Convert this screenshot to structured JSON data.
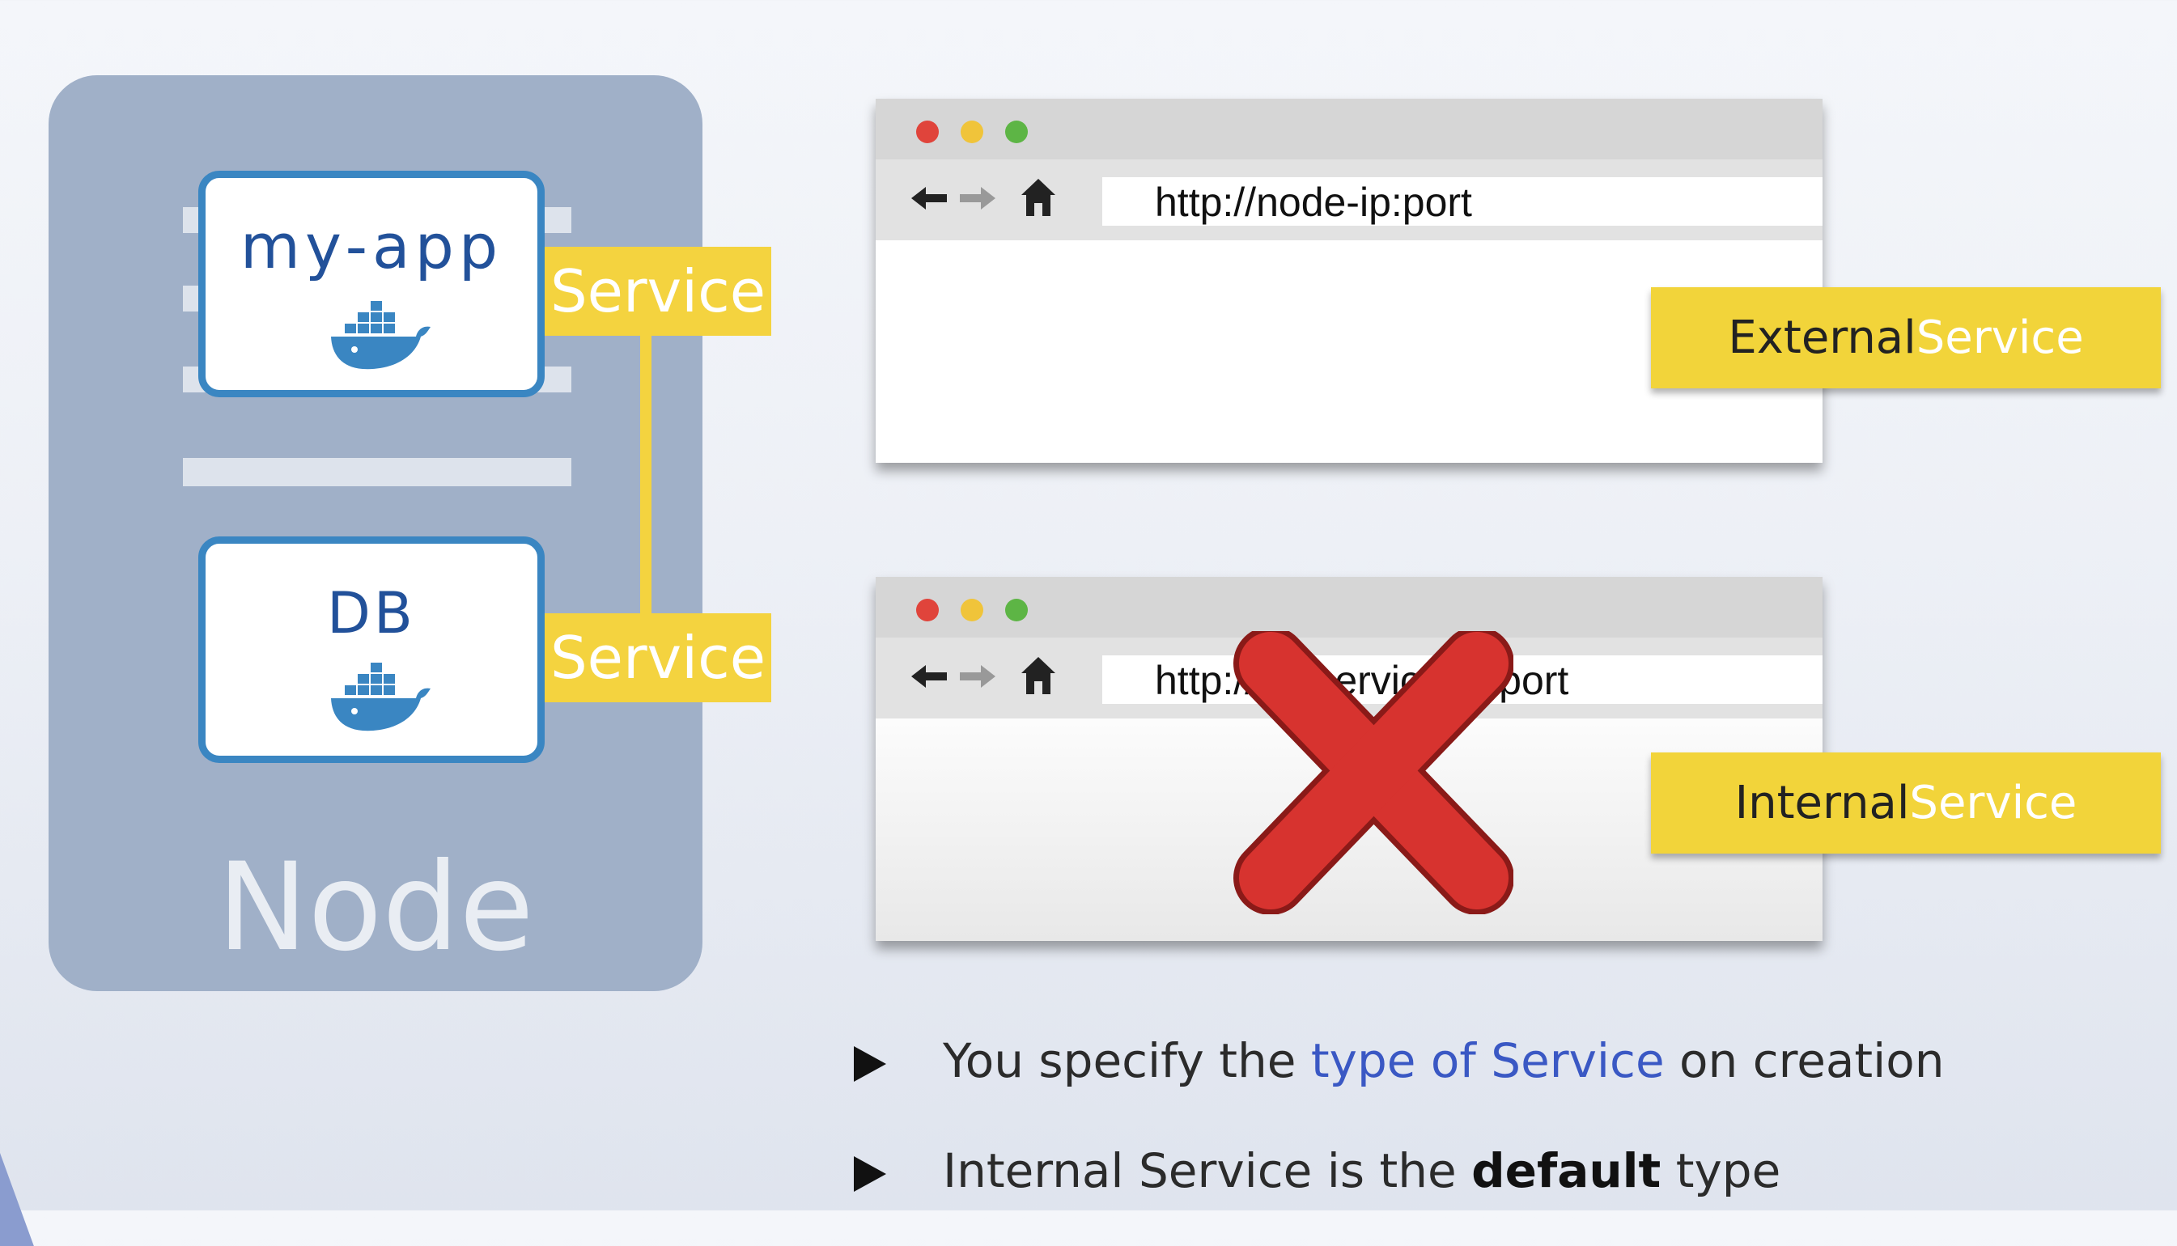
{
  "node": {
    "label": "Node",
    "pods": [
      {
        "label": "my-app",
        "icon": "docker-whale-icon"
      },
      {
        "label": "DB",
        "icon": "docker-whale-icon"
      }
    ],
    "service_tags": [
      "Service",
      "Service"
    ]
  },
  "browsers": [
    {
      "url": "http://node-ip:port",
      "badge_dark": "External ",
      "badge_light": "Service",
      "blocked": false
    },
    {
      "url": "http://db-service-ip:port",
      "badge_dark": "Internal ",
      "badge_light": "Service",
      "blocked": true
    }
  ],
  "bullets": [
    {
      "before": "You specify the ",
      "highlight": "type of Service",
      "after": " on creation"
    },
    {
      "before": "Internal Service is the ",
      "bold": "default",
      "after": " type"
    }
  ],
  "colors": {
    "node_panel": "#a0b0c8",
    "pod_border": "#3a86c2",
    "service_yellow": "#f4d33f",
    "highlight_blue": "#3a58c4",
    "cross_red": "#d7332f"
  }
}
